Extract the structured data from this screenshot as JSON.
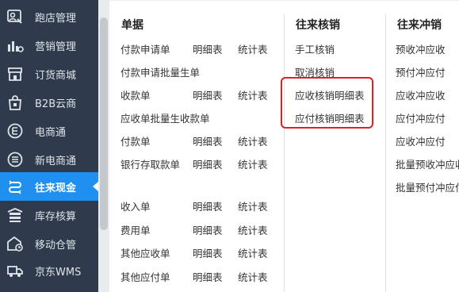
{
  "sidebar": {
    "items": [
      {
        "label": "跑店管理",
        "icon": "store-visit-icon"
      },
      {
        "label": "营销管理",
        "icon": "marketing-chart-icon"
      },
      {
        "label": "订货商城",
        "icon": "mall-icon"
      },
      {
        "label": "B2B云商",
        "icon": "b2b-bag-icon"
      },
      {
        "label": "电商通",
        "icon": "ecommerce-icon"
      },
      {
        "label": "新电商通",
        "icon": "new-ecommerce-icon"
      },
      {
        "label": "往来现金",
        "icon": "cash-flow-icon",
        "active": true
      },
      {
        "label": "库存核算",
        "icon": "inventory-icon"
      },
      {
        "label": "移动仓管",
        "icon": "mobile-warehouse-icon"
      },
      {
        "label": "京东WMS",
        "icon": "truck-icon"
      }
    ]
  },
  "menu": {
    "col1": {
      "title": "单据",
      "rows": [
        [
          "付款申请单",
          "明细表",
          "统计表"
        ],
        [
          "付款申请批量生单"
        ],
        [
          "收款单",
          "明细表",
          "统计表"
        ],
        [
          "应收单批量生收款单"
        ],
        [
          "付款单",
          "明细表",
          "统计表"
        ],
        [
          "银行存取款单",
          "明细表",
          "统计表"
        ],
        [
          "收入单",
          "明细表",
          "统计表"
        ],
        [
          "费用单",
          "明细表",
          "统计表"
        ],
        [
          "其他应收单",
          "明细表",
          "统计表"
        ],
        [
          "其他应付单",
          "明细表",
          "统计表"
        ]
      ]
    },
    "col2": {
      "title": "往来核销",
      "items": [
        "手工核销",
        "取消核销",
        "应收核销明细表",
        "应付核销明细表"
      ]
    },
    "col3": {
      "title": "往来冲销",
      "items": [
        "预收冲应收",
        "预付冲应付",
        "应收冲应收",
        "应付冲应付",
        "应收冲应付",
        "批量预收冲应收",
        "批量预付冲应付"
      ]
    }
  },
  "colors": {
    "sidebar_bg": "#2f3b4c",
    "active_bg": "#1f8ff0",
    "highlight": "#e02020"
  }
}
